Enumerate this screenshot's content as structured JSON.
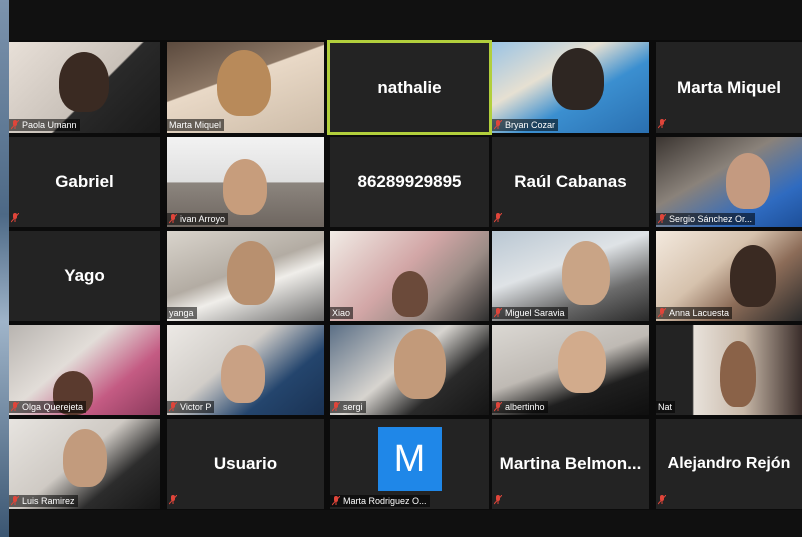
{
  "colors": {
    "tile_bg": "#232323",
    "active_border": "#b2cf3c",
    "muted_mic": "#e0453a",
    "avatar_blue": "#1f87e8"
  },
  "participants": [
    {
      "name": "Paola Umann",
      "video": true,
      "muted": true
    },
    {
      "name": "Marta Miquel",
      "video": true,
      "muted": false
    },
    {
      "name": "nathalie",
      "video": false,
      "muted": false,
      "active_speaker": true
    },
    {
      "name": "Bryan Cozar",
      "video": true,
      "muted": true
    },
    {
      "name": "Marta Miquel",
      "video": false,
      "muted": true
    },
    {
      "name": "Gabriel",
      "video": false,
      "muted": true
    },
    {
      "name": "ivan Arroyo",
      "video": true,
      "muted": true
    },
    {
      "name": "86289929895",
      "video": false,
      "muted": false
    },
    {
      "name": "Raúl Cabanas",
      "video": false,
      "muted": true
    },
    {
      "name": "Sergio Sánchez Or...",
      "video": true,
      "muted": true
    },
    {
      "name": "Yago",
      "video": false,
      "muted": false
    },
    {
      "name": "yanga",
      "video": true,
      "muted": false
    },
    {
      "name": "Xiao",
      "video": true,
      "muted": false
    },
    {
      "name": "Miguel Saravia",
      "video": true,
      "muted": true
    },
    {
      "name": "Anna Lacuesta",
      "video": true,
      "muted": true
    },
    {
      "name": "Olga Querejeta",
      "video": true,
      "muted": true
    },
    {
      "name": "Victor P",
      "video": true,
      "muted": true
    },
    {
      "name": "sergi",
      "video": true,
      "muted": true
    },
    {
      "name": "albertinho",
      "video": true,
      "muted": true
    },
    {
      "name": "Nat",
      "video": true,
      "muted": false
    },
    {
      "name": "Luis Ramirez",
      "video": true,
      "muted": true
    },
    {
      "name": "Usuario",
      "video": false,
      "muted": true
    },
    {
      "name": "Marta Rodriguez O...",
      "video": false,
      "muted": true,
      "avatar_letter": "M"
    },
    {
      "name": "Martina  Belmon...",
      "video": false,
      "muted": true
    },
    {
      "name": "Alejandro Rejón",
      "video": false,
      "muted": true
    }
  ]
}
